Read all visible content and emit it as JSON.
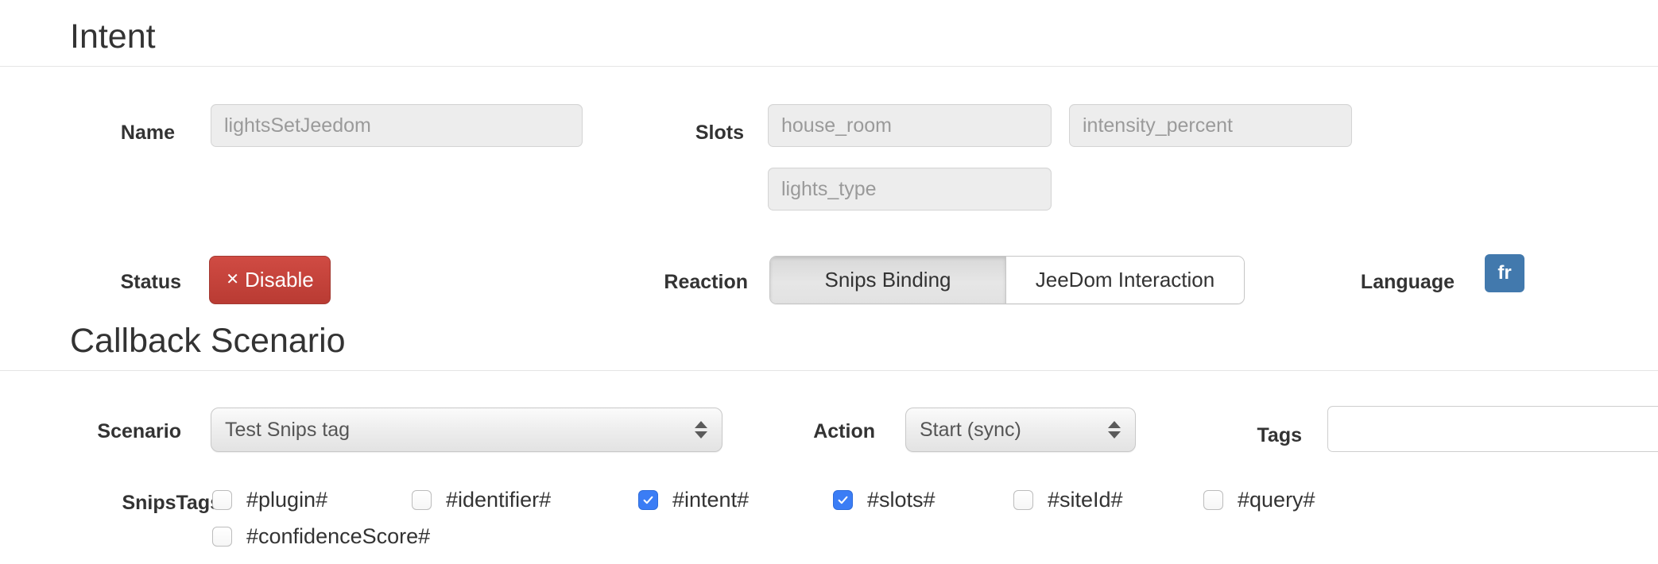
{
  "sections": {
    "intent": {
      "title": "Intent",
      "name_label": "Name",
      "name_value": "lightsSetJeedom",
      "slots_label": "Slots",
      "slots": [
        {
          "value": "house_room"
        },
        {
          "value": "intensity_percent"
        },
        {
          "value": "lights_type"
        }
      ],
      "status_label": "Status",
      "status_button": {
        "icon": "times-icon",
        "label": "Disable",
        "color": "#b93b33"
      },
      "reaction_label": "Reaction",
      "reaction_options": [
        {
          "label": "Snips Binding",
          "active": true
        },
        {
          "label": "JeeDom Interaction",
          "active": false
        }
      ],
      "language_label": "Language",
      "language_value": "fr",
      "language_color": "#4279ad"
    },
    "callback": {
      "title": "Callback Scenario",
      "scenario_label": "Scenario",
      "scenario_value": "Test Snips tag",
      "action_label": "Action",
      "action_value": "Start (sync)",
      "tags_label": "Tags",
      "tags_value": "",
      "snipstags_label": "SnipsTags",
      "snipstags": [
        {
          "label": "#plugin#",
          "checked": false
        },
        {
          "label": "#identifier#",
          "checked": false
        },
        {
          "label": "#intent#",
          "checked": true
        },
        {
          "label": "#slots#",
          "checked": true
        },
        {
          "label": "#siteId#",
          "checked": false
        },
        {
          "label": "#query#",
          "checked": false
        },
        {
          "label": "#confidenceScore#",
          "checked": false
        }
      ],
      "checkbox_checked_color": "#3b7df5"
    }
  }
}
